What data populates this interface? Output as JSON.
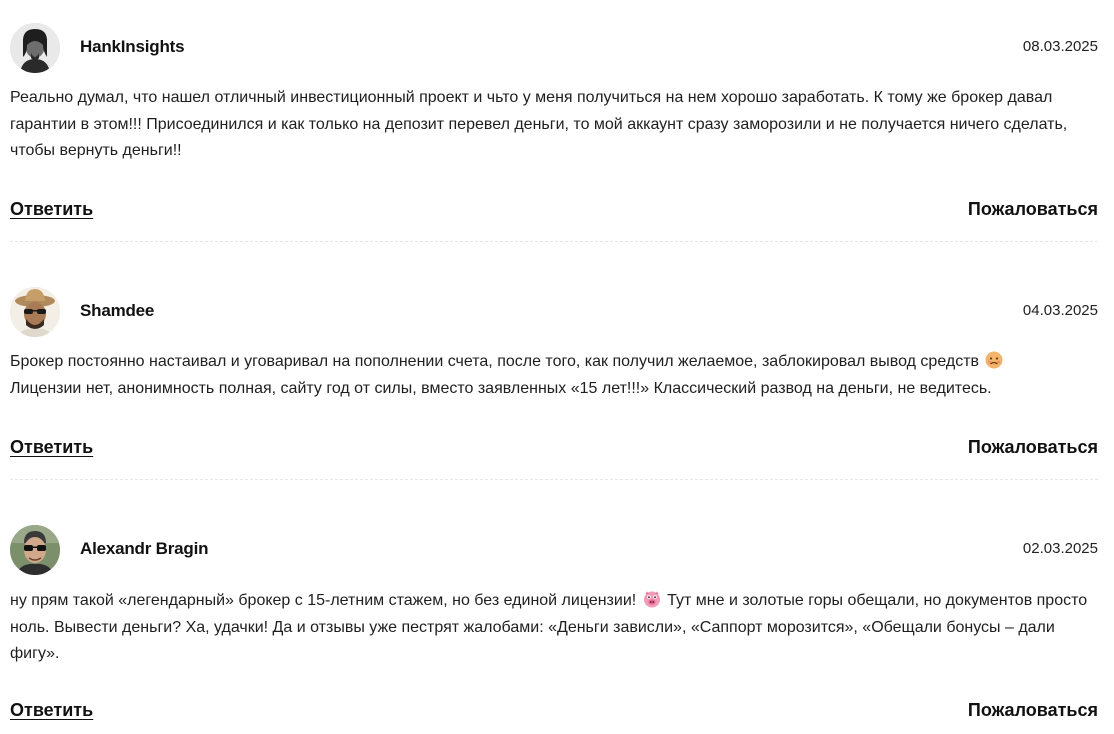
{
  "comments": [
    {
      "author": "HankInsights",
      "date": "08.03.2025",
      "avatar_icon": "user-photo-bw",
      "text_parts": [
        "Реально думал, что нашел отличный инвестиционный проект и чьто у меня получиться на нем хорошо заработать. К тому же брокер давал гарантии в этом!!! Присоединился и как только на депозит перевел деньги, то мой аккаунт сразу заморозили и не получается ничего сделать, чтобы вернуть деньги!!"
      ],
      "reply_label": "Ответить",
      "report_label": "Пожаловаться"
    },
    {
      "author": "Shamdee",
      "date": "04.03.2025",
      "avatar_icon": "user-photo-hat",
      "text_parts": [
        "Брокер постоянно настаивал и уговаривал на пополнении счета, после того, как получил желаемое, заблокировал вывод средств",
        "Лицензии нет, анонимность полная, сайту год от силы, вместо заявленных «15 лет!!!» Классический развод на деньги, не ведитесь."
      ],
      "emoji": "sad-face-emoji",
      "reply_label": "Ответить",
      "report_label": "Пожаловаться"
    },
    {
      "author": "Alexandr Bragin",
      "date": "02.03.2025",
      "avatar_icon": "user-photo-sunglasses",
      "text_parts": [
        "ну прям такой «легендарный» брокер с 15-летним стажем, но без единой лицензии!",
        "Тут мне и золотые горы обещали, но документов просто ноль. Вывести деньги? Ха, удачки! Да и отзывы уже пестрят жалобами: «Деньги зависли», «Саппорт морозится», «Обещали бонусы – дали фигу»."
      ],
      "emoji": "pig-face-emoji",
      "reply_label": "Ответить",
      "report_label": "Пожаловаться"
    }
  ]
}
